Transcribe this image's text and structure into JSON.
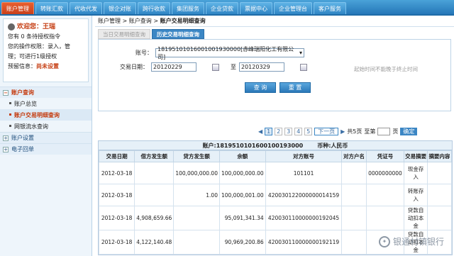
{
  "topnav": [
    "账户管理",
    "转账汇款",
    "代收代发",
    "银企对账",
    "跨行收款",
    "集团服务",
    "企业贷款",
    "票据中心",
    "企业管理台",
    "客户服务"
  ],
  "welcome": {
    "greeting": "欢迎您：王瑞",
    "line1": "您有 0 条待授权指令",
    "line2": "您的操作权限：录入，管",
    "line3": "理；可进行1级授权",
    "line4_label": "预留信息：",
    "line4_value": "尚未设置"
  },
  "menu": {
    "group1": "账户查询",
    "items": [
      "账户总览",
      "账户交易明细查询",
      "网银流水查询"
    ],
    "group2": "账户设置",
    "group3": "电子回单"
  },
  "breadcrumb": "账户管理 > 账户查询 > 账户交易明细查询",
  "breadcrumb_prefix": "账户管理 > 账户查询 >",
  "breadcrumb_last": "账户交易明细查询",
  "subtabs": [
    "当日交易明细查询",
    "历史交易明细查询"
  ],
  "form": {
    "account_label": "账号：",
    "account_value": "18195101016001001930000[赤峰瑞阳化工有限公司]",
    "date_label": "交易日期：",
    "date_from": "20120229",
    "date_to_label": "至",
    "date_to": "20120329",
    "hint": "起始时间不能晚于终止时间",
    "query_btn": "查 询",
    "reset_btn": "重 置"
  },
  "pager": {
    "pages": [
      "1",
      "2",
      "3",
      "4",
      "5"
    ],
    "next": "下一页",
    "total": "共5页",
    "goto": "至第",
    "unit": "页",
    "confirm": "确定"
  },
  "grid": {
    "account": "账户:1819510101600100193000",
    "currency": "币种:人民币",
    "headers": [
      "交易日期",
      "借方发生额",
      "贷方发生额",
      "余额",
      "对方账号",
      "对方户名",
      "凭证号",
      "交易摘要",
      "摘要内容"
    ],
    "rows": [
      [
        "2012-03-18",
        "",
        "100,000,000.00",
        "100,000,000.00",
        "101101",
        "",
        "0000000000",
        "现金存入",
        ""
      ],
      [
        "2012-03-18",
        "",
        "1.00",
        "100,000,001.00",
        "420030122000000014159",
        "",
        "",
        "转账存入",
        ""
      ],
      [
        "2012-03-18",
        "4,908,659.66",
        "",
        "95,091,341.34",
        "420030110000000192045",
        "",
        "",
        "贷款自动扣本金",
        ""
      ],
      [
        "2012-03-18",
        "4,122,140.48",
        "",
        "90,969,200.86",
        "420030110000000192119",
        "",
        "",
        "贷款自动扣本金",
        ""
      ]
    ]
  },
  "watermark": "银通村镇银行"
}
